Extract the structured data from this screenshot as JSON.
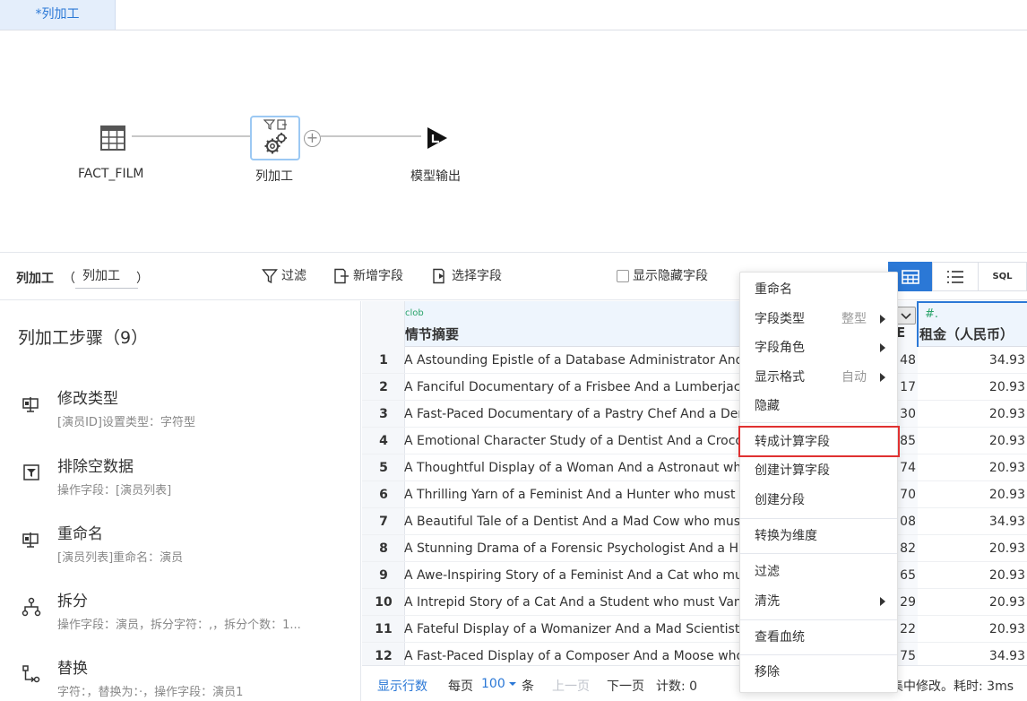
{
  "tab": {
    "label": "*列加工"
  },
  "flow": {
    "nodes": [
      {
        "label": "FACT_FILM",
        "icon": "table-grid-icon"
      },
      {
        "label": "列加工",
        "icon": "gear-cluster-icon"
      },
      {
        "label": "模型输出",
        "icon": "output-arrow-icon"
      }
    ]
  },
  "toolbar": {
    "title": "列加工",
    "paren_open": "（",
    "paren_close": "）",
    "name_value": "列加工",
    "filter_label": "过滤",
    "add_field_label": "新增字段",
    "select_field_label": "选择字段",
    "show_hidden_label": "显示隐藏字段",
    "view_sql": "SQL"
  },
  "steps": {
    "title": "列加工步骤（9）",
    "items": [
      {
        "title": "修改类型",
        "desc": "[演员ID]设置类型：字符型",
        "icon": "modify-type-icon"
      },
      {
        "title": "排除空数据",
        "desc": "操作字段：[演员列表]",
        "icon": "filter-empty-icon"
      },
      {
        "title": "重命名",
        "desc": "[演员列表]重命名：演员",
        "icon": "rename-icon"
      },
      {
        "title": "拆分",
        "desc": "操作字段：演员，拆分字符：,，拆分个数：1...",
        "icon": "split-icon"
      },
      {
        "title": "替换",
        "desc": "字符：，替换为：·，操作字段：演员1",
        "icon": "replace-icon"
      }
    ]
  },
  "table": {
    "columns": [
      {
        "type": "clob",
        "name": "情节摘要"
      },
      {
        "type": "",
        "name": "E"
      },
      {
        "type": "#.",
        "name": "租金（人民币）"
      }
    ],
    "rows": [
      {
        "n": "1",
        "summary": "A Astounding Epistle of a Database Administrator And a E",
        "mid": "48",
        "rent": "34.93"
      },
      {
        "n": "2",
        "summary": "A Fanciful Documentary of a Frisbee And a Lumberjack w",
        "mid": "17",
        "rent": "20.93"
      },
      {
        "n": "3",
        "summary": "A Fast-Paced Documentary of a Pastry Chef And a Denti",
        "mid": "30",
        "rent": "20.93"
      },
      {
        "n": "4",
        "summary": "A Emotional Character Study of a Dentist And a Crocodil",
        "mid": "85",
        "rent": "20.93"
      },
      {
        "n": "5",
        "summary": "A Thoughtful Display of a Woman And a Astronaut who m",
        "mid": "74",
        "rent": "20.93"
      },
      {
        "n": "6",
        "summary": "A Thrilling Yarn of a Feminist And a Hunter who must Figh",
        "mid": "70",
        "rent": "20.93"
      },
      {
        "n": "7",
        "summary": "A Beautiful Tale of a Dentist And a Mad Cow who must B",
        "mid": "08",
        "rent": "34.93"
      },
      {
        "n": "8",
        "summary": "A Stunning Drama of a Forensic Psychologist And a Husb",
        "mid": "82",
        "rent": "20.93"
      },
      {
        "n": "9",
        "summary": "A Awe-Inspiring Story of a Feminist And a Cat who must C",
        "mid": "65",
        "rent": "20.93"
      },
      {
        "n": "10",
        "summary": "A Intrepid Story of a Cat And a Student who must Vanqui",
        "mid": "29",
        "rent": "20.93"
      },
      {
        "n": "11",
        "summary": "A Fateful Display of a Womanizer And a Mad Scientist wh",
        "mid": "22",
        "rent": "20.93"
      },
      {
        "n": "12",
        "summary": "A Fast-Paced Display of a Composer And a Moose who r",
        "mid": "75",
        "rent": "34.93"
      }
    ]
  },
  "footer": {
    "show_rows": "显示行数",
    "per_page": "每页",
    "page_size": "100",
    "unit": "条",
    "prev": "上一页",
    "next": "下一页",
    "count": "计数: 0",
    "status": "集中修改。耗时: 3ms"
  },
  "context_menu": {
    "items": [
      {
        "label": "重命名"
      },
      {
        "label": "字段类型",
        "sub": "整型",
        "arrow": true
      },
      {
        "label": "字段角色",
        "arrow": true
      },
      {
        "label": "显示格式",
        "sub": "自动",
        "arrow": true
      },
      {
        "label": "隐藏"
      },
      {
        "label": "转成计算字段",
        "highlighted": true
      },
      {
        "label": "创建计算字段"
      },
      {
        "label": "创建分段"
      },
      {
        "label": "转换为维度"
      },
      {
        "label": "过滤"
      },
      {
        "label": "清洗",
        "arrow": true
      },
      {
        "label": "查看血统"
      },
      {
        "label": "移除"
      }
    ]
  },
  "colors": {
    "accent": "#2b78d6",
    "highlight": "#e03131",
    "header_bg": "#eef5fd"
  }
}
